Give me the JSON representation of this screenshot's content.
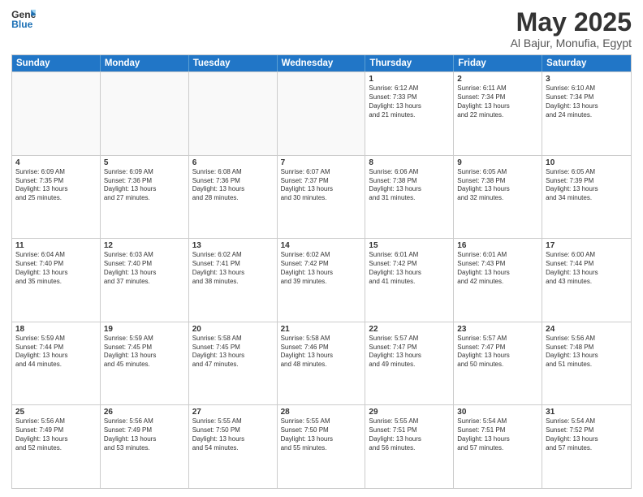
{
  "logo": {
    "line1": "General",
    "line2": "Blue"
  },
  "title": "May 2025",
  "subtitle": "Al Bajur, Monufia, Egypt",
  "header_days": [
    "Sunday",
    "Monday",
    "Tuesday",
    "Wednesday",
    "Thursday",
    "Friday",
    "Saturday"
  ],
  "rows": [
    [
      {
        "day": "",
        "text": ""
      },
      {
        "day": "",
        "text": ""
      },
      {
        "day": "",
        "text": ""
      },
      {
        "day": "",
        "text": ""
      },
      {
        "day": "1",
        "text": "Sunrise: 6:12 AM\nSunset: 7:33 PM\nDaylight: 13 hours\nand 21 minutes."
      },
      {
        "day": "2",
        "text": "Sunrise: 6:11 AM\nSunset: 7:34 PM\nDaylight: 13 hours\nand 22 minutes."
      },
      {
        "day": "3",
        "text": "Sunrise: 6:10 AM\nSunset: 7:34 PM\nDaylight: 13 hours\nand 24 minutes."
      }
    ],
    [
      {
        "day": "4",
        "text": "Sunrise: 6:09 AM\nSunset: 7:35 PM\nDaylight: 13 hours\nand 25 minutes."
      },
      {
        "day": "5",
        "text": "Sunrise: 6:09 AM\nSunset: 7:36 PM\nDaylight: 13 hours\nand 27 minutes."
      },
      {
        "day": "6",
        "text": "Sunrise: 6:08 AM\nSunset: 7:36 PM\nDaylight: 13 hours\nand 28 minutes."
      },
      {
        "day": "7",
        "text": "Sunrise: 6:07 AM\nSunset: 7:37 PM\nDaylight: 13 hours\nand 30 minutes."
      },
      {
        "day": "8",
        "text": "Sunrise: 6:06 AM\nSunset: 7:38 PM\nDaylight: 13 hours\nand 31 minutes."
      },
      {
        "day": "9",
        "text": "Sunrise: 6:05 AM\nSunset: 7:38 PM\nDaylight: 13 hours\nand 32 minutes."
      },
      {
        "day": "10",
        "text": "Sunrise: 6:05 AM\nSunset: 7:39 PM\nDaylight: 13 hours\nand 34 minutes."
      }
    ],
    [
      {
        "day": "11",
        "text": "Sunrise: 6:04 AM\nSunset: 7:40 PM\nDaylight: 13 hours\nand 35 minutes."
      },
      {
        "day": "12",
        "text": "Sunrise: 6:03 AM\nSunset: 7:40 PM\nDaylight: 13 hours\nand 37 minutes."
      },
      {
        "day": "13",
        "text": "Sunrise: 6:02 AM\nSunset: 7:41 PM\nDaylight: 13 hours\nand 38 minutes."
      },
      {
        "day": "14",
        "text": "Sunrise: 6:02 AM\nSunset: 7:42 PM\nDaylight: 13 hours\nand 39 minutes."
      },
      {
        "day": "15",
        "text": "Sunrise: 6:01 AM\nSunset: 7:42 PM\nDaylight: 13 hours\nand 41 minutes."
      },
      {
        "day": "16",
        "text": "Sunrise: 6:01 AM\nSunset: 7:43 PM\nDaylight: 13 hours\nand 42 minutes."
      },
      {
        "day": "17",
        "text": "Sunrise: 6:00 AM\nSunset: 7:44 PM\nDaylight: 13 hours\nand 43 minutes."
      }
    ],
    [
      {
        "day": "18",
        "text": "Sunrise: 5:59 AM\nSunset: 7:44 PM\nDaylight: 13 hours\nand 44 minutes."
      },
      {
        "day": "19",
        "text": "Sunrise: 5:59 AM\nSunset: 7:45 PM\nDaylight: 13 hours\nand 45 minutes."
      },
      {
        "day": "20",
        "text": "Sunrise: 5:58 AM\nSunset: 7:45 PM\nDaylight: 13 hours\nand 47 minutes."
      },
      {
        "day": "21",
        "text": "Sunrise: 5:58 AM\nSunset: 7:46 PM\nDaylight: 13 hours\nand 48 minutes."
      },
      {
        "day": "22",
        "text": "Sunrise: 5:57 AM\nSunset: 7:47 PM\nDaylight: 13 hours\nand 49 minutes."
      },
      {
        "day": "23",
        "text": "Sunrise: 5:57 AM\nSunset: 7:47 PM\nDaylight: 13 hours\nand 50 minutes."
      },
      {
        "day": "24",
        "text": "Sunrise: 5:56 AM\nSunset: 7:48 PM\nDaylight: 13 hours\nand 51 minutes."
      }
    ],
    [
      {
        "day": "25",
        "text": "Sunrise: 5:56 AM\nSunset: 7:49 PM\nDaylight: 13 hours\nand 52 minutes."
      },
      {
        "day": "26",
        "text": "Sunrise: 5:56 AM\nSunset: 7:49 PM\nDaylight: 13 hours\nand 53 minutes."
      },
      {
        "day": "27",
        "text": "Sunrise: 5:55 AM\nSunset: 7:50 PM\nDaylight: 13 hours\nand 54 minutes."
      },
      {
        "day": "28",
        "text": "Sunrise: 5:55 AM\nSunset: 7:50 PM\nDaylight: 13 hours\nand 55 minutes."
      },
      {
        "day": "29",
        "text": "Sunrise: 5:55 AM\nSunset: 7:51 PM\nDaylight: 13 hours\nand 56 minutes."
      },
      {
        "day": "30",
        "text": "Sunrise: 5:54 AM\nSunset: 7:51 PM\nDaylight: 13 hours\nand 57 minutes."
      },
      {
        "day": "31",
        "text": "Sunrise: 5:54 AM\nSunset: 7:52 PM\nDaylight: 13 hours\nand 57 minutes."
      }
    ]
  ]
}
